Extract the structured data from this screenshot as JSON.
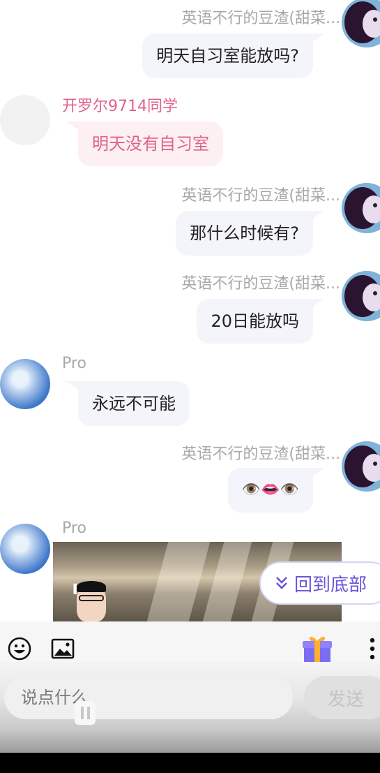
{
  "messages": [
    {
      "side": "me",
      "name": "英语不行的豆渣(甜菜...",
      "text": "明天自习室能放吗?"
    },
    {
      "side": "other",
      "name": "开罗尔9714同学",
      "text": "明天没有自习室",
      "name_color": "#e0628a"
    },
    {
      "side": "me",
      "name": "英语不行的豆渣(甜菜...",
      "text": "那什么时候有?"
    },
    {
      "side": "me",
      "name": "英语不行的豆渣(甜菜...",
      "text": "20日能放吗"
    },
    {
      "side": "other",
      "name": "Pro",
      "text": "永远不可能",
      "name_color": "#a8a8a8"
    },
    {
      "side": "me",
      "name": "英语不行的豆渣(甜菜...",
      "text": "👁️👄👁️"
    },
    {
      "side": "other",
      "name": "Pro",
      "name_color": "#a8a8a8",
      "image": "photo-with-man"
    }
  ],
  "back_to_bottom": {
    "icon": "double-chevron-down-icon",
    "label": "回到底部"
  },
  "toolbar": {
    "icons": [
      "emoji-icon",
      "image-icon",
      "gift-icon",
      "more-vertical-icon"
    ]
  },
  "composer": {
    "placeholder": "说点什么",
    "send_label": "发送"
  },
  "colors": {
    "accent": "#6a55d6",
    "pink": "#e0628a",
    "bubble": "#f4f4fb"
  }
}
